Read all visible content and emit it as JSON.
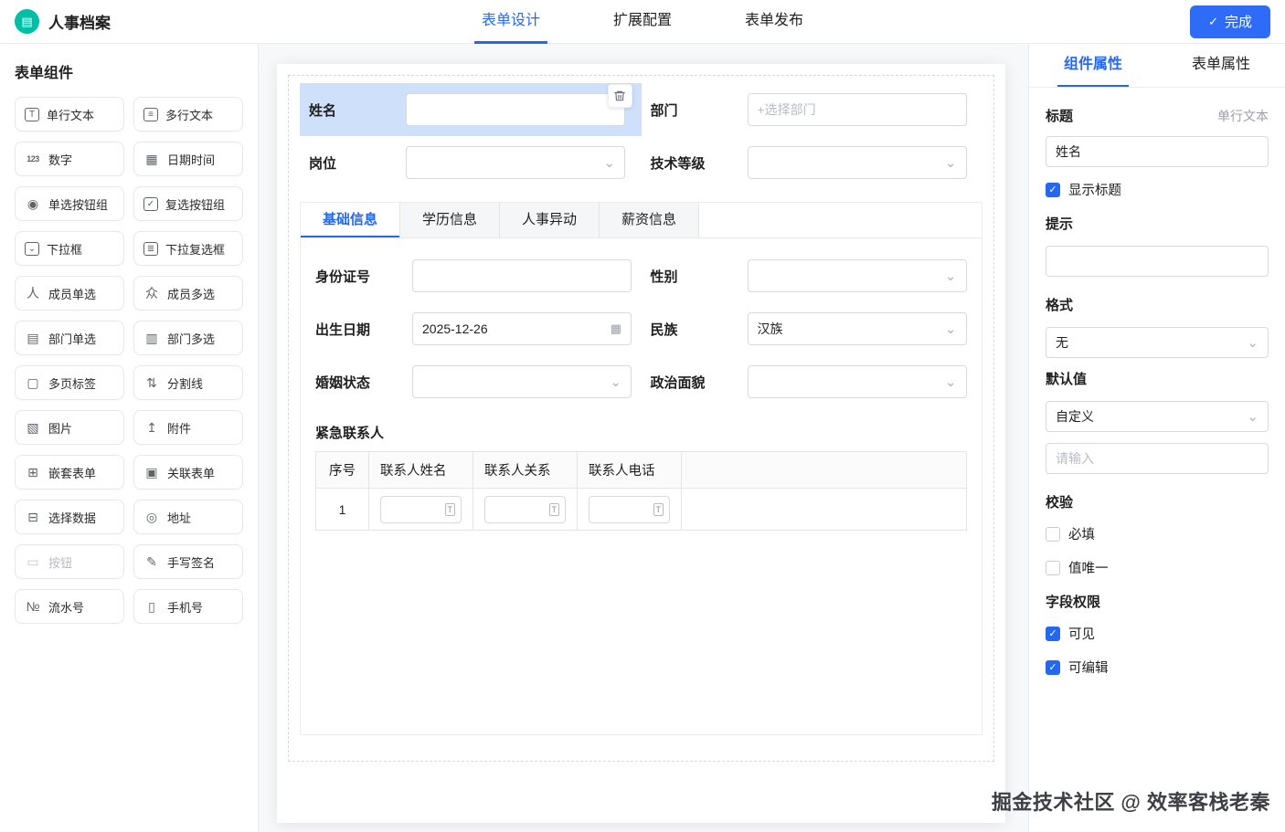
{
  "colors": {
    "accent": "#2468f2",
    "brand": "#00bfa5",
    "selected_field_bg": "#cfe0fb"
  },
  "icons": {
    "logo": "▤",
    "check": "✓",
    "chevron_down": "⌄",
    "calendar": "▦",
    "text_field_small": "T"
  },
  "header": {
    "app_title": "人事档案",
    "nav_tabs": [
      {
        "label": "表单设计",
        "active": true
      },
      {
        "label": "扩展配置",
        "active": false
      },
      {
        "label": "表单发布",
        "active": false
      }
    ],
    "finish_button_label": "完成"
  },
  "component_panel": {
    "title": "表单组件",
    "items": [
      {
        "label": "单行文本",
        "icon": "single-line-text-icon",
        "glyph": "T"
      },
      {
        "label": "多行文本",
        "icon": "multi-line-text-icon",
        "glyph": "≡"
      },
      {
        "label": "数字",
        "icon": "number-icon",
        "glyph": "123"
      },
      {
        "label": "日期时间",
        "icon": "datetime-icon",
        "glyph": "▦"
      },
      {
        "label": "单选按钮组",
        "icon": "radio-group-icon",
        "glyph": "◉"
      },
      {
        "label": "复选按钮组",
        "icon": "checkbox-group-icon",
        "glyph": "✓"
      },
      {
        "label": "下拉框",
        "icon": "dropdown-icon",
        "glyph": "⌄"
      },
      {
        "label": "下拉复选框",
        "icon": "dropdown-multi-icon",
        "glyph": "≣"
      },
      {
        "label": "成员单选",
        "icon": "member-single-icon",
        "glyph": "人"
      },
      {
        "label": "成员多选",
        "icon": "member-multi-icon",
        "glyph": "众"
      },
      {
        "label": "部门单选",
        "icon": "department-single-icon",
        "glyph": "▤"
      },
      {
        "label": "部门多选",
        "icon": "department-multi-icon",
        "glyph": "▥"
      },
      {
        "label": "多页标签",
        "icon": "multi-tab-icon",
        "glyph": "▢"
      },
      {
        "label": "分割线",
        "icon": "divider-icon",
        "glyph": "⇅"
      },
      {
        "label": "图片",
        "icon": "image-icon",
        "glyph": "▧"
      },
      {
        "label": "附件",
        "icon": "attachment-icon",
        "glyph": "↥"
      },
      {
        "label": "嵌套表单",
        "icon": "nested-form-icon",
        "glyph": "⊞"
      },
      {
        "label": "关联表单",
        "icon": "linked-form-icon",
        "glyph": "▣"
      },
      {
        "label": "选择数据",
        "icon": "select-data-icon",
        "glyph": "⊟"
      },
      {
        "label": "地址",
        "icon": "address-icon",
        "glyph": "◎"
      },
      {
        "label": "按钮",
        "icon": "button-icon",
        "glyph": "▭",
        "disabled": true
      },
      {
        "label": "手写签名",
        "icon": "signature-icon",
        "glyph": "✎"
      },
      {
        "label": "流水号",
        "icon": "serial-number-icon",
        "glyph": "№"
      },
      {
        "label": "手机号",
        "icon": "phone-icon",
        "glyph": "▯"
      }
    ]
  },
  "canvas": {
    "top_fields": {
      "name": {
        "label": "姓名",
        "value": "",
        "selected": true
      },
      "department": {
        "label": "部门",
        "placeholder": "+选择部门"
      },
      "position": {
        "label": "岗位",
        "value": ""
      },
      "tech_level": {
        "label": "技术等级",
        "value": ""
      }
    },
    "page_tabs": [
      {
        "label": "基础信息",
        "active": true
      },
      {
        "label": "学历信息",
        "active": false
      },
      {
        "label": "人事异动",
        "active": false
      },
      {
        "label": "薪资信息",
        "active": false
      }
    ],
    "tab_fields": {
      "id_number": {
        "label": "身份证号",
        "value": ""
      },
      "gender": {
        "label": "性别",
        "value": ""
      },
      "birth_date": {
        "label": "出生日期",
        "value": "2025-12-26"
      },
      "ethnicity": {
        "label": "民族",
        "value": "汉族"
      },
      "marital_status": {
        "label": "婚姻状态",
        "value": ""
      },
      "political_status": {
        "label": "政治面貌",
        "value": ""
      }
    },
    "emergency_contacts": {
      "title": "紧急联系人",
      "columns": [
        "序号",
        "联系人姓名",
        "联系人关系",
        "联系人电话"
      ],
      "rows": [
        {
          "index": "1"
        }
      ]
    }
  },
  "properties_panel": {
    "tabs": [
      {
        "label": "组件属性",
        "active": true
      },
      {
        "label": "表单属性",
        "active": false
      }
    ],
    "component_type": "单行文本",
    "title_field": {
      "label": "标题",
      "value": "姓名"
    },
    "show_title": {
      "label": "显示标题",
      "checked": true
    },
    "hint": {
      "label": "提示",
      "value": ""
    },
    "format": {
      "label": "格式",
      "value": "无"
    },
    "default_value": {
      "label": "默认值",
      "value": "自定义",
      "input_placeholder": "请输入"
    },
    "validation": {
      "label": "校验",
      "required": {
        "label": "必填",
        "checked": false
      },
      "unique": {
        "label": "值唯一",
        "checked": false
      }
    },
    "field_permission": {
      "label": "字段权限",
      "visible": {
        "label": "可见",
        "checked": true
      },
      "editable": {
        "label": "可编辑",
        "checked": true
      }
    }
  },
  "watermark": "掘金技术社区 @ 效率客栈老秦"
}
